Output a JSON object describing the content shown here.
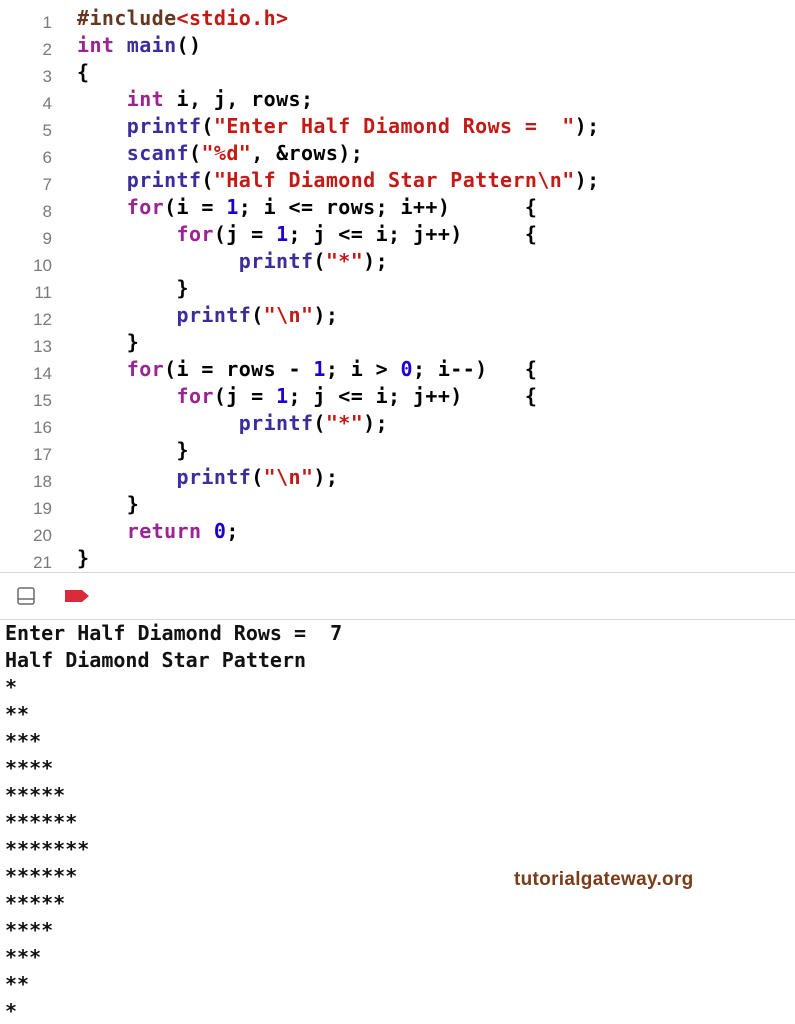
{
  "editor": {
    "lines": [
      {
        "number": "1",
        "tokens": [
          {
            "text": "#include",
            "kind": "preproc"
          },
          {
            "text": "<stdio.h>",
            "kind": "header"
          }
        ]
      },
      {
        "number": "2",
        "tokens": [
          {
            "text": "int",
            "kind": "keyword"
          },
          {
            "text": " ",
            "kind": "plain"
          },
          {
            "text": "main",
            "kind": "func"
          },
          {
            "text": "()",
            "kind": "plain"
          }
        ]
      },
      {
        "number": "3",
        "tokens": [
          {
            "text": "{",
            "kind": "plain"
          }
        ]
      },
      {
        "number": "4",
        "tokens": [
          {
            "text": "    ",
            "kind": "plain"
          },
          {
            "text": "int",
            "kind": "keyword"
          },
          {
            "text": " i, j, rows;",
            "kind": "plain"
          }
        ]
      },
      {
        "number": "5",
        "tokens": [
          {
            "text": "    ",
            "kind": "plain"
          },
          {
            "text": "printf",
            "kind": "func"
          },
          {
            "text": "(",
            "kind": "plain"
          },
          {
            "text": "\"Enter Half Diamond Rows =  \"",
            "kind": "string"
          },
          {
            "text": ");",
            "kind": "plain"
          }
        ]
      },
      {
        "number": "6",
        "tokens": [
          {
            "text": "    ",
            "kind": "plain"
          },
          {
            "text": "scanf",
            "kind": "func"
          },
          {
            "text": "(",
            "kind": "plain"
          },
          {
            "text": "\"%d\"",
            "kind": "string"
          },
          {
            "text": ", &rows);",
            "kind": "plain"
          }
        ]
      },
      {
        "number": "7",
        "tokens": [
          {
            "text": "    ",
            "kind": "plain"
          },
          {
            "text": "printf",
            "kind": "func"
          },
          {
            "text": "(",
            "kind": "plain"
          },
          {
            "text": "\"Half Diamond Star Pattern\\n\"",
            "kind": "string"
          },
          {
            "text": ");",
            "kind": "plain"
          }
        ]
      },
      {
        "number": "8",
        "tokens": [
          {
            "text": "    ",
            "kind": "plain"
          },
          {
            "text": "for",
            "kind": "keyword"
          },
          {
            "text": "(i = ",
            "kind": "plain"
          },
          {
            "text": "1",
            "kind": "number"
          },
          {
            "text": "; i <= rows; i++)      {",
            "kind": "plain"
          }
        ]
      },
      {
        "number": "9",
        "tokens": [
          {
            "text": "        ",
            "kind": "plain"
          },
          {
            "text": "for",
            "kind": "keyword"
          },
          {
            "text": "(j = ",
            "kind": "plain"
          },
          {
            "text": "1",
            "kind": "number"
          },
          {
            "text": "; j <= i; j++)     {",
            "kind": "plain"
          }
        ]
      },
      {
        "number": "10",
        "tokens": [
          {
            "text": "             ",
            "kind": "plain"
          },
          {
            "text": "printf",
            "kind": "func"
          },
          {
            "text": "(",
            "kind": "plain"
          },
          {
            "text": "\"*\"",
            "kind": "string"
          },
          {
            "text": ");",
            "kind": "plain"
          }
        ]
      },
      {
        "number": "11",
        "tokens": [
          {
            "text": "        }",
            "kind": "plain"
          }
        ]
      },
      {
        "number": "12",
        "tokens": [
          {
            "text": "        ",
            "kind": "plain"
          },
          {
            "text": "printf",
            "kind": "func"
          },
          {
            "text": "(",
            "kind": "plain"
          },
          {
            "text": "\"\\n\"",
            "kind": "string"
          },
          {
            "text": ");",
            "kind": "plain"
          }
        ]
      },
      {
        "number": "13",
        "tokens": [
          {
            "text": "    }",
            "kind": "plain"
          }
        ]
      },
      {
        "number": "14",
        "tokens": [
          {
            "text": "    ",
            "kind": "plain"
          },
          {
            "text": "for",
            "kind": "keyword"
          },
          {
            "text": "(i = rows - ",
            "kind": "plain"
          },
          {
            "text": "1",
            "kind": "number"
          },
          {
            "text": "; i > ",
            "kind": "plain"
          },
          {
            "text": "0",
            "kind": "number"
          },
          {
            "text": "; i--)   {",
            "kind": "plain"
          }
        ]
      },
      {
        "number": "15",
        "tokens": [
          {
            "text": "        ",
            "kind": "plain"
          },
          {
            "text": "for",
            "kind": "keyword"
          },
          {
            "text": "(j = ",
            "kind": "plain"
          },
          {
            "text": "1",
            "kind": "number"
          },
          {
            "text": "; j <= i; j++)     {",
            "kind": "plain"
          }
        ]
      },
      {
        "number": "16",
        "tokens": [
          {
            "text": "             ",
            "kind": "plain"
          },
          {
            "text": "printf",
            "kind": "func"
          },
          {
            "text": "(",
            "kind": "plain"
          },
          {
            "text": "\"*\"",
            "kind": "string"
          },
          {
            "text": ");",
            "kind": "plain"
          }
        ]
      },
      {
        "number": "17",
        "tokens": [
          {
            "text": "        }",
            "kind": "plain"
          }
        ]
      },
      {
        "number": "18",
        "tokens": [
          {
            "text": "        ",
            "kind": "plain"
          },
          {
            "text": "printf",
            "kind": "func"
          },
          {
            "text": "(",
            "kind": "plain"
          },
          {
            "text": "\"\\n\"",
            "kind": "string"
          },
          {
            "text": ");",
            "kind": "plain"
          }
        ]
      },
      {
        "number": "19",
        "tokens": [
          {
            "text": "    }",
            "kind": "plain"
          }
        ]
      },
      {
        "number": "20",
        "tokens": [
          {
            "text": "    ",
            "kind": "plain"
          },
          {
            "text": "return",
            "kind": "keyword"
          },
          {
            "text": " ",
            "kind": "plain"
          },
          {
            "text": "0",
            "kind": "number"
          },
          {
            "text": ";",
            "kind": "plain"
          }
        ]
      },
      {
        "number": "21",
        "tokens": [
          {
            "text": "}",
            "kind": "plain"
          }
        ]
      }
    ]
  },
  "debug_bar": {
    "hide_console_icon": "panel-toggle-icon",
    "breakpoints_icon": "breakpoint-icon",
    "breakpoint_color": "#d92b3a"
  },
  "console": {
    "lines": [
      "Enter Half Diamond Rows =  7",
      "Half Diamond Star Pattern",
      "*",
      "**",
      "***",
      "****",
      "*****",
      "******",
      "*******",
      "******",
      "*****",
      "****",
      "***",
      "**",
      "*"
    ]
  },
  "watermark": {
    "text": "tutorialgateway.org"
  }
}
